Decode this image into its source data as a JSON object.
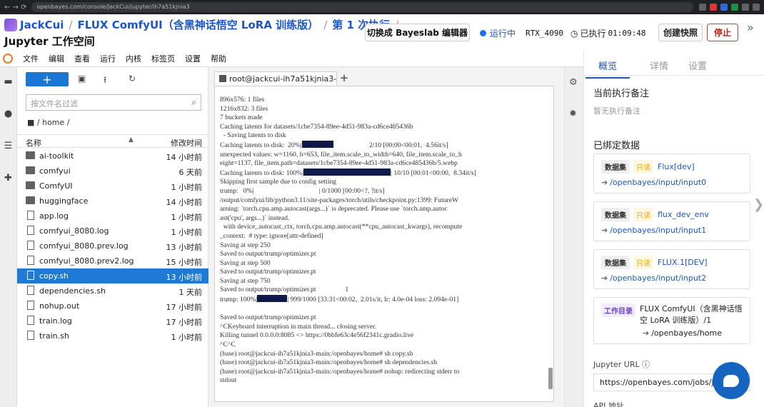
{
  "browser": {
    "url": "openbayes.com/console/JackCui/jupyter/ih7a51kjnia3"
  },
  "header": {
    "crumb_user": "JackCui",
    "crumb_project": "FLUX ComfyUI（含黑神话悟空 LoRA 训练版）",
    "crumb_run": "第 1 次执行",
    "subtitle": "Jupyter 工作空间",
    "switch_label": "切换成 Bayeslab 编辑器",
    "status_label": "运行中",
    "gpu": "RTX_4090",
    "elapsed_label": "已执行",
    "elapsed": "01:09:48",
    "snapshot_label": "创建快照",
    "stop_label": "停止"
  },
  "menu": [
    "文件",
    "编辑",
    "查看",
    "运行",
    "内核",
    "标签页",
    "设置",
    "帮助"
  ],
  "filebrowser": {
    "new_label": "+",
    "filter_placeholder": "按文件名过滤",
    "path": "/ home /",
    "col_name": "名称",
    "col_modified": "修改时间",
    "files": [
      {
        "name": "ai-toolkit",
        "time": "14 小时前",
        "type": "folder"
      },
      {
        "name": "comfyui",
        "time": "6 天前",
        "type": "folder"
      },
      {
        "name": "ComfyUI",
        "time": "1 小时前",
        "type": "folder"
      },
      {
        "name": "huggingface",
        "time": "14 小时前",
        "type": "folder"
      },
      {
        "name": "app.log",
        "time": "1 小时前",
        "type": "file"
      },
      {
        "name": "comfyui_8080.log",
        "time": "1 小时前",
        "type": "file"
      },
      {
        "name": "comfyui_8080.prev.log",
        "time": "13 小时前",
        "type": "file"
      },
      {
        "name": "comfyui_8080.prev2.log",
        "time": "15 小时前",
        "type": "file"
      },
      {
        "name": "copy.sh",
        "time": "13 小时前",
        "type": "file",
        "selected": true
      },
      {
        "name": "dependencies.sh",
        "time": "1 天前",
        "type": "file"
      },
      {
        "name": "nohup.out",
        "time": "17 小时前",
        "type": "file"
      },
      {
        "name": "train.log",
        "time": "17 小时前",
        "type": "file"
      },
      {
        "name": "train.sh",
        "time": "1 小时前",
        "type": "file"
      }
    ]
  },
  "terminal": {
    "tab_label": "root@jackcui-ih7a51kjnia3-n",
    "lines": [
      "896x576: 1 files",
      "1216x832: 3 files",
      "7 buckets made",
      "Caching latents for datasets/1cbe7354-89ee-4d51-983a-cd6ce485436b",
      "  - Saving latents to disk",
      "Caching latents to disk:  20%|[BAR1]                     2/10 [00:00<00:01,  4.56it/s]",
      "unexpected values: w=1160, h=653, file_item.scale_to_width=640, file_item.scale_to_h",
      "eight=1137, file_item.path=datasets/1cbe7354-89ee-4d51-983a-cd6ce485436b/5.webp",
      "Caching latents to disk: 100%|[BAR2]| 10/10 [00:01<00:00,  8.34it/s]",
      "Skipping first sample due to config setting",
      "trump:   0%|                                      | 0/1000 [00:00<?, ?it/s]",
      "/output/comfyui/lib/python3.11/site-packages/torch/utils/checkpoint.py:1399: FutureW",
      "arning: `torch.cpu.amp.autocast(args...)` is deprecated. Please use `torch.amp.autoc",
      "ast('cpu', args...)` instead.",
      "  with device_autocast_ctx, torch.cpu.amp.autocast(**cpu_autocast_kwargs), recompute",
      "_context:  # type: ignore[attr-defined]",
      "Saving at step 250",
      "Saved to output/trump/optimizer.pt",
      "Saving at step 500",
      "Saved to output/trump/optimizer.pt",
      "Saving at step 750",
      "Saved to output/trump/optimizer.pt                 1",
      "trump: 100%|[BAR3]| 999/1000 [33:31<00:02,  2.01s/it, lr: 4.0e-04 loss: 2.094e-01]",
      "",
      "Saved to output/trump/optimizer.pt",
      "^CKeyboard interruption in main thread... closing server.",
      "Killing tunnel 0.0.0.0:8085 <> https://0bbfe63c4e56f2341c.gradio.live",
      "^C^C",
      "(base) root@jackcui-ih7a51kjnia3-main:/openbayes/home# sh copy.sh",
      "(base) root@jackcui-ih7a51kjnia3-main:/openbayes/home# sh dependencies.sh",
      "(base) root@jackcui-ih7a51kjnia3-main:/openbayes/home# nohup: redirecting stderr to",
      "stdout"
    ]
  },
  "info": {
    "tabs": [
      "概览",
      "详情",
      "设置"
    ],
    "note_title": "当前执行备注",
    "note_empty": "暂无执行备注",
    "bound_title": "已绑定数据",
    "datasets": [
      {
        "tag": "数据集",
        "ro": "只读",
        "name": "Flux[dev]",
        "mount": "/openbayes/input/input0"
      },
      {
        "tag": "数据集",
        "ro": "只读",
        "name": "flux_dev_env",
        "mount": "/openbayes/input/input1"
      },
      {
        "tag": "数据集",
        "ro": "只读",
        "name": "FLUX.1[DEV]",
        "mount": "/openbayes/input/input2"
      }
    ],
    "workdir": {
      "tag": "工作目录",
      "name": "FLUX ComfyUI（含黑神话悟空 LoRA 训练版）/1",
      "mount": "/openbayes/home"
    },
    "jupyter_url_label": "Jupyter URL",
    "jupyter_url": "https://openbayes.com/jobs/j",
    "api_label": "API 地址"
  }
}
